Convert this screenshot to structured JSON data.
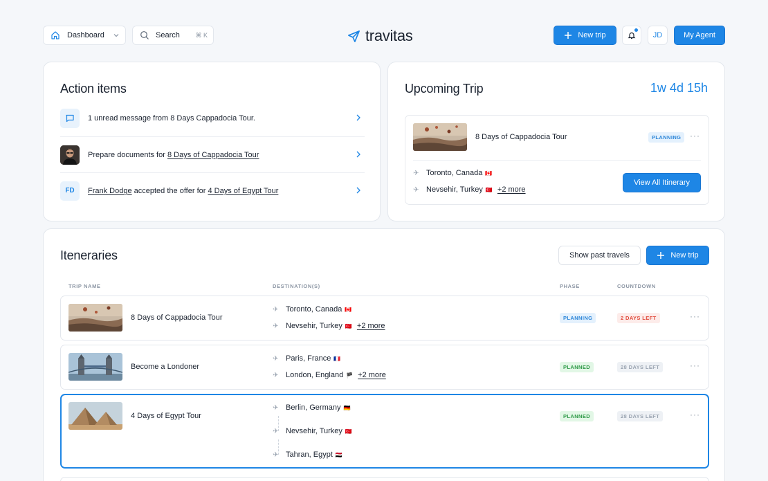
{
  "header": {
    "nav_label": "Dashboard",
    "search_label": "Search",
    "search_shortcut": "⌘ K",
    "brand": "travitas",
    "new_trip_label": "New trip",
    "user_initials": "JD",
    "agent_label": "My Agent"
  },
  "action_items": {
    "title": "Action items",
    "items": [
      {
        "icon": "message-icon",
        "text": "1 unread message from 8 Days Cappadocia Tour."
      },
      {
        "icon": "avatar-photo",
        "prefix": "Prepare documents for ",
        "link": "8 Days of Cappadocia Tour"
      },
      {
        "icon": "initials",
        "initials": "FD",
        "name": "Frank Dodge",
        "middle": " accepted the offer for ",
        "link": "4 Days of Egypt Tour"
      }
    ]
  },
  "upcoming": {
    "title": "Upcoming Trip",
    "countdown": "1w 4d 15h",
    "trip_name": "8 Days of Cappadocia Tour",
    "phase": "PLANNING",
    "origin": "Toronto, Canada",
    "origin_flag": "🇨🇦",
    "destination": "Nevsehir, Turkey",
    "destination_flag": "🇹🇷",
    "more": "+2 more",
    "view_label": "View All Itinerary"
  },
  "itineraries": {
    "title": "Iteneraries",
    "past_label": "Show past travels",
    "new_trip_label": "New trip",
    "columns": [
      "TRIP NAME",
      "DESTINATION(S)",
      "PHASE",
      "COUNTDOWN"
    ],
    "rows": [
      {
        "name": "8 Days of Cappadocia Tour",
        "origin": "Toronto, Canada",
        "origin_flag": "🇨🇦",
        "destination": "Nevsehir, Turkey",
        "destination_flag": "🇹🇷",
        "more": "+2 more",
        "phase": "PLANNING",
        "countdown": "2 DAYS LEFT"
      },
      {
        "name": "Become a Londoner",
        "origin": "Paris, France",
        "origin_flag": "🇫🇷",
        "destination": "London, England",
        "destination_flag": "🏴",
        "more": "+2 more",
        "phase": "PLANNED",
        "countdown": "28 DAYS LEFT"
      },
      {
        "name": "4 Days of Egypt Tour",
        "origin": "Berlin, Germany",
        "origin_flag": "🇩🇪",
        "stop": "Nevsehir, Turkey",
        "stop_flag": "🇹🇷",
        "destination": "Tahran, Egypt",
        "destination_flag": "🇪🇬",
        "phase": "PLANNED",
        "countdown": "28 DAYS LEFT"
      }
    ]
  },
  "colors": {
    "accent": "#1e86e5",
    "planning": "#2d86d8",
    "planned": "#2f9a48",
    "urgent": "#e0493a"
  }
}
